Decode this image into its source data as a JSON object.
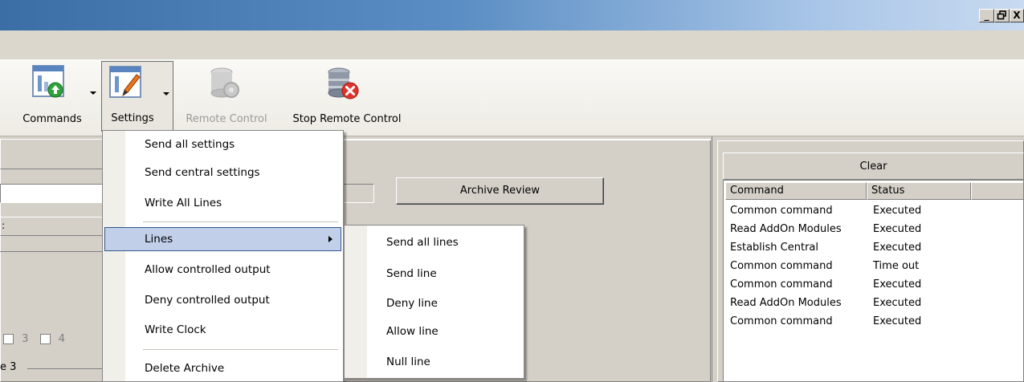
{
  "window": {
    "controls": [
      "_",
      "ə",
      "X"
    ]
  },
  "toolbar": {
    "commands_label": "Commands",
    "settings_label": "Settings",
    "remote_control_label": "Remote Control",
    "stop_remote_control_label": "Stop Remote Control"
  },
  "main": {
    "archive_review_label": "Archive Review",
    "checkbox_labels": [
      "3",
      "4"
    ],
    "partial_group_label": "e 3"
  },
  "log": {
    "clear_label": "Clear",
    "columns": [
      "Command",
      "Status"
    ],
    "rows": [
      {
        "command": "Common command",
        "status": "Executed"
      },
      {
        "command": "Read AddOn Modules",
        "status": "Executed"
      },
      {
        "command": "Establish Central",
        "status": "Executed"
      },
      {
        "command": "Common command",
        "status": "Time out"
      },
      {
        "command": "Common command",
        "status": "Executed"
      },
      {
        "command": "Read AddOn Modules",
        "status": "Executed"
      },
      {
        "command": "Common command",
        "status": "Executed"
      }
    ]
  },
  "settings_menu": {
    "items": [
      "Send all settings",
      "Send central settings",
      "Write All Lines",
      "Lines",
      "Allow controlled output",
      "Deny controlled output",
      "Write Clock",
      "Delete Archive"
    ]
  },
  "lines_submenu": {
    "items": [
      "Send all lines",
      "Send line",
      "Deny line",
      "Allow line",
      "Null line"
    ]
  },
  "colors": {
    "highlight": "#c1cfe8",
    "highlight_border": "#32588f",
    "title_bar": "#3a6ea5"
  }
}
